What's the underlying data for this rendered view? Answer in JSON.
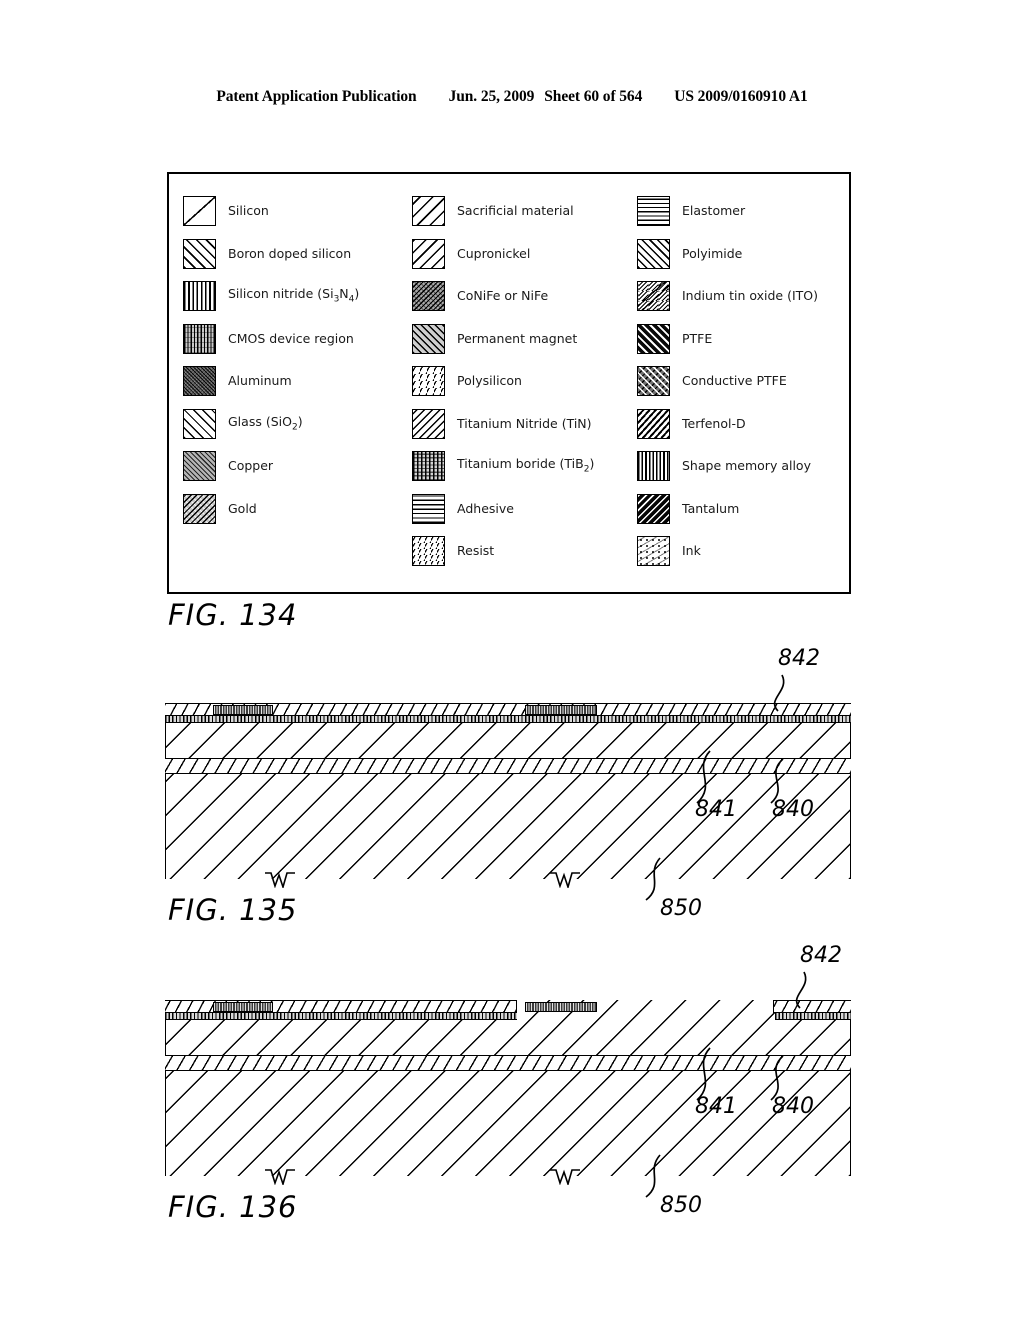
{
  "header": {
    "publication": "Patent Application Publication",
    "date": "Jun. 25, 2009",
    "sheet": "Sheet 60 of 564",
    "doc_number": "US 2009/0160910 A1"
  },
  "legend": {
    "caption": "FIG. 134",
    "columns": [
      {
        "items": [
          {
            "label": "Silicon",
            "pattern": "sw-silicon"
          },
          {
            "label": "Boron doped silicon",
            "pattern": "sw-boron"
          },
          {
            "label": "Silicon nitride (Si3N4)",
            "pattern": "sw-si3n4",
            "html": "Silicon nitride (Si<sub>3</sub>N<sub>4</sub>)"
          },
          {
            "label": "CMOS device region",
            "pattern": "sw-cmos"
          },
          {
            "label": "Aluminum",
            "pattern": "sw-aluminum"
          },
          {
            "label": "Glass (SiO2)",
            "pattern": "sw-glass",
            "html": "Glass (SiO<sub>2</sub>)"
          },
          {
            "label": "Copper",
            "pattern": "sw-copper"
          },
          {
            "label": "Gold",
            "pattern": "sw-gold"
          }
        ]
      },
      {
        "items": [
          {
            "label": "Sacrificial material",
            "pattern": "sw-sacrificial"
          },
          {
            "label": "Cupronickel",
            "pattern": "sw-cupronickel"
          },
          {
            "label": "CoNiFe or NiFe",
            "pattern": "sw-conife"
          },
          {
            "label": "Permanent magnet",
            "pattern": "sw-permmag"
          },
          {
            "label": "Polysilicon",
            "pattern": "sw-polysilicon"
          },
          {
            "label": "Titanium Nitride (TiN)",
            "pattern": "sw-tin"
          },
          {
            "label": "Titanium boride (TiB2)",
            "pattern": "sw-tib2",
            "html": "Titanium boride (TiB<sub>2</sub>)"
          },
          {
            "label": "Adhesive",
            "pattern": "sw-adhesive"
          },
          {
            "label": "Resist",
            "pattern": "sw-resist"
          }
        ]
      },
      {
        "items": [
          {
            "label": "Elastomer",
            "pattern": "sw-elastomer"
          },
          {
            "label": "Polyimide",
            "pattern": "sw-polyimide"
          },
          {
            "label": "Indium tin oxide (ITO)",
            "pattern": "sw-ito"
          },
          {
            "label": "PTFE",
            "pattern": "sw-ptfe"
          },
          {
            "label": "Conductive PTFE",
            "pattern": "sw-cond-ptfe"
          },
          {
            "label": "Terfenol-D",
            "pattern": "sw-terfenol"
          },
          {
            "label": "Shape memory alloy",
            "pattern": "sw-sma"
          },
          {
            "label": "Tantalum",
            "pattern": "sw-tantalum"
          },
          {
            "label": "Ink",
            "pattern": "sw-ink"
          }
        ]
      }
    ]
  },
  "figures": [
    {
      "caption": "FIG. 135",
      "refs": {
        "top_layer": "842",
        "mid_upper": "841",
        "mid_lower": "840",
        "substrate": "850"
      },
      "top_layer_full_width": true
    },
    {
      "caption": "FIG. 136",
      "refs": {
        "top_layer": "842",
        "mid_upper": "841",
        "mid_lower": "840",
        "substrate": "850"
      },
      "top_layer_full_width": false
    }
  ]
}
